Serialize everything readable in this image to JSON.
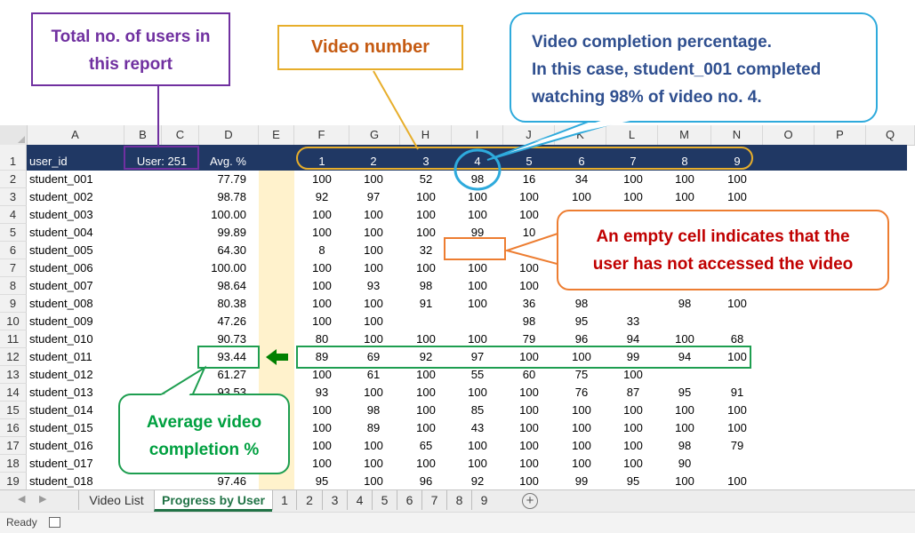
{
  "columns": [
    "A",
    "B",
    "C",
    "D",
    "E",
    "F",
    "G",
    "H",
    "I",
    "J",
    "K",
    "L",
    "M",
    "N",
    "O",
    "P",
    "Q"
  ],
  "header_row": {
    "user_id": "user_id",
    "user_count": "User:  251",
    "avg": "Avg. %",
    "videos": [
      "1",
      "2",
      "3",
      "4",
      "5",
      "6",
      "7",
      "8",
      "9"
    ]
  },
  "rows": [
    {
      "num": "2",
      "user": "student_001",
      "avg": "77.79",
      "v": [
        "100",
        "100",
        "52",
        "98",
        "16",
        "34",
        "100",
        "100",
        "100"
      ]
    },
    {
      "num": "3",
      "user": "student_002",
      "avg": "98.78",
      "v": [
        "92",
        "97",
        "100",
        "100",
        "100",
        "100",
        "100",
        "100",
        "100"
      ]
    },
    {
      "num": "4",
      "user": "student_003",
      "avg": "100.00",
      "v": [
        "100",
        "100",
        "100",
        "100",
        "100",
        "",
        "",
        "",
        ""
      ]
    },
    {
      "num": "5",
      "user": "student_004",
      "avg": "99.89",
      "v": [
        "100",
        "100",
        "100",
        "99",
        "10",
        "",
        "",
        "",
        ""
      ]
    },
    {
      "num": "6",
      "user": "student_005",
      "avg": "64.30",
      "v": [
        "8",
        "100",
        "32",
        "",
        "100",
        "",
        "",
        "",
        ""
      ]
    },
    {
      "num": "7",
      "user": "student_006",
      "avg": "100.00",
      "v": [
        "100",
        "100",
        "100",
        "100",
        "100",
        "",
        "",
        "",
        ""
      ]
    },
    {
      "num": "8",
      "user": "student_007",
      "avg": "98.64",
      "v": [
        "100",
        "93",
        "98",
        "100",
        "100",
        "",
        "",
        "",
        ""
      ]
    },
    {
      "num": "9",
      "user": "student_008",
      "avg": "80.38",
      "v": [
        "100",
        "100",
        "91",
        "100",
        "36",
        "98",
        "",
        "98",
        "100"
      ]
    },
    {
      "num": "10",
      "user": "student_009",
      "avg": "47.26",
      "v": [
        "100",
        "100",
        "",
        "",
        "98",
        "95",
        "33",
        "",
        ""
      ]
    },
    {
      "num": "11",
      "user": "student_010",
      "avg": "90.73",
      "v": [
        "80",
        "100",
        "100",
        "100",
        "79",
        "96",
        "94",
        "100",
        "68"
      ]
    },
    {
      "num": "12",
      "user": "student_011",
      "avg": "93.44",
      "v": [
        "89",
        "69",
        "92",
        "97",
        "100",
        "100",
        "99",
        "94",
        "100"
      ]
    },
    {
      "num": "13",
      "user": "student_012",
      "avg": "61.27",
      "v": [
        "100",
        "61",
        "100",
        "55",
        "60",
        "75",
        "100",
        "",
        ""
      ]
    },
    {
      "num": "14",
      "user": "student_013",
      "avg": "93.53",
      "v": [
        "93",
        "100",
        "100",
        "100",
        "100",
        "76",
        "87",
        "95",
        "91"
      ]
    },
    {
      "num": "15",
      "user": "student_014",
      "avg": "",
      "v": [
        "100",
        "98",
        "100",
        "85",
        "100",
        "100",
        "100",
        "100",
        "100"
      ]
    },
    {
      "num": "16",
      "user": "student_015",
      "avg": "",
      "v": [
        "100",
        "89",
        "100",
        "43",
        "100",
        "100",
        "100",
        "100",
        "100"
      ]
    },
    {
      "num": "17",
      "user": "student_016",
      "avg": "",
      "v": [
        "100",
        "100",
        "65",
        "100",
        "100",
        "100",
        "100",
        "98",
        "79"
      ]
    },
    {
      "num": "18",
      "user": "student_017",
      "avg": "",
      "v": [
        "100",
        "100",
        "100",
        "100",
        "100",
        "100",
        "100",
        "90",
        ""
      ]
    },
    {
      "num": "19",
      "user": "student_018",
      "avg": "97.46",
      "v": [
        "95",
        "100",
        "96",
        "92",
        "100",
        "99",
        "95",
        "100",
        "100"
      ]
    }
  ],
  "tabs": [
    "Video List",
    "Progress by User",
    "1",
    "2",
    "3",
    "4",
    "5",
    "6",
    "7",
    "8",
    "9"
  ],
  "status": "Ready",
  "callouts": {
    "users": "Total no. of users in this report",
    "video_number": "Video number",
    "completion_line1": "Video completion percentage.",
    "completion_line2": "In this case, student_001 completed",
    "completion_line3": "watching 98% of video no. 4.",
    "empty_line1": "An empty cell indicates that the",
    "empty_line2": "user has not accessed the video",
    "avg_line1": "Average video",
    "avg_line2": "completion %"
  },
  "colors": {
    "header_band": "#203864",
    "purple": "#7030a0",
    "orange": "#ed7d31",
    "gold": "#e7ae2b",
    "blue": "#2eaadc",
    "green": "#1e9e50",
    "darkred": "#c00000",
    "navy": "#2f4f8f"
  }
}
